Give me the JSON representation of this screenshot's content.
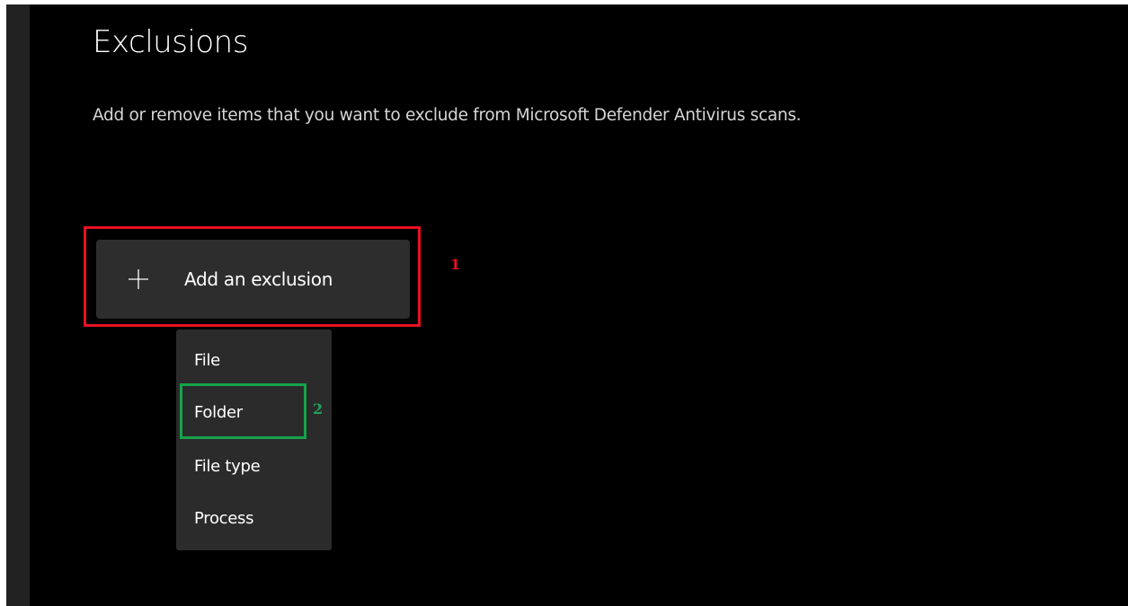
{
  "page": {
    "title": "Exclusions",
    "description": "Add or remove items that you want to exclude from Microsoft Defender Antivirus scans."
  },
  "add_button": {
    "icon": "plus-icon",
    "label": "Add an exclusion"
  },
  "dropdown": {
    "items": [
      {
        "label": "File"
      },
      {
        "label": "Folder"
      },
      {
        "label": "File type"
      },
      {
        "label": "Process"
      }
    ]
  },
  "annotations": {
    "step1": {
      "number": "1",
      "color": "#e81123"
    },
    "step2": {
      "number": "2",
      "color": "#22a35a"
    }
  },
  "colors": {
    "background": "#000000",
    "button": "#2d2d2d",
    "menu": "#2b2b2b",
    "text": "#ffffff"
  }
}
